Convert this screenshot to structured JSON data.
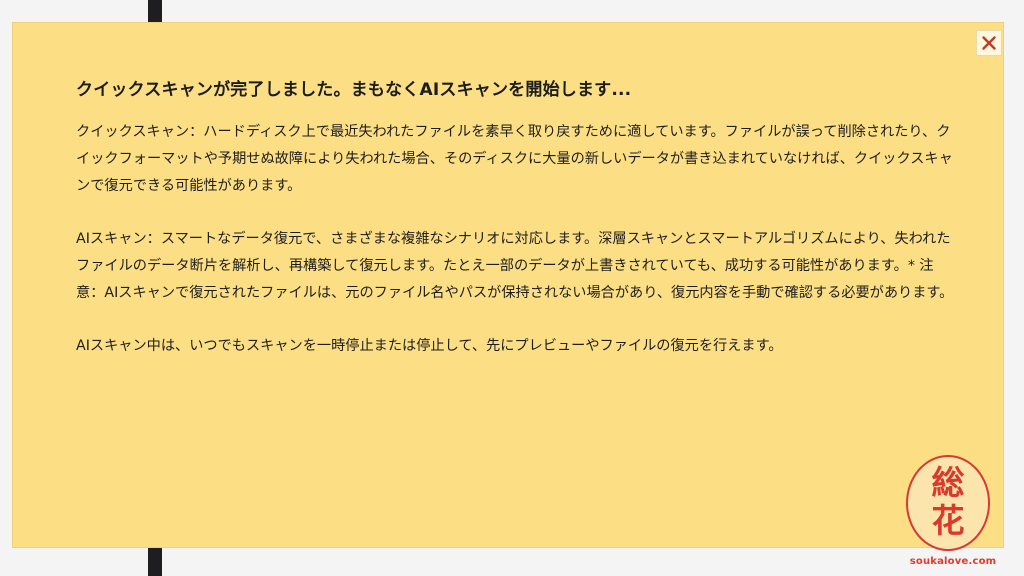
{
  "dialog": {
    "title": "クイックスキャンが完了しました。まもなくAIスキャンを開始します...",
    "paragraphs": [
      "クイックスキャン：ハードディスク上で最近失われたファイルを素早く取り戻すために適しています。ファイルが誤って削除されたり、クイックフォーマットや予期せぬ故障により失われた場合、そのディスクに大量の新しいデータが書き込まれていなければ、クイックスキャンで復元できる可能性があります。",
      "AIスキャン：スマートなデータ復元で、さまざまな複雑なシナリオに対応します。深層スキャンとスマートアルゴリズムにより、失われたファイルのデータ断片を解析し、再構築して復元します。たとえ一部のデータが上書きされていても、成功する可能性があります。* 注意：AIスキャンで復元されたファイルは、元のファイル名やパスが保持されない場合があり、復元内容を手動で確認する必要があります。",
      "AIスキャン中は、いつでもスキャンを一時停止または停止して、先にプレビューやファイルの復元を行えます。"
    ],
    "close_icon": "close-icon"
  },
  "watermark": {
    "seal_chars": [
      "総",
      "花"
    ],
    "url": "soukalove.com"
  },
  "colors": {
    "popup_background": "#fcdf85",
    "close_icon": "#c0392b",
    "text": "#1e1e1e",
    "watermark": "#d9392f"
  }
}
